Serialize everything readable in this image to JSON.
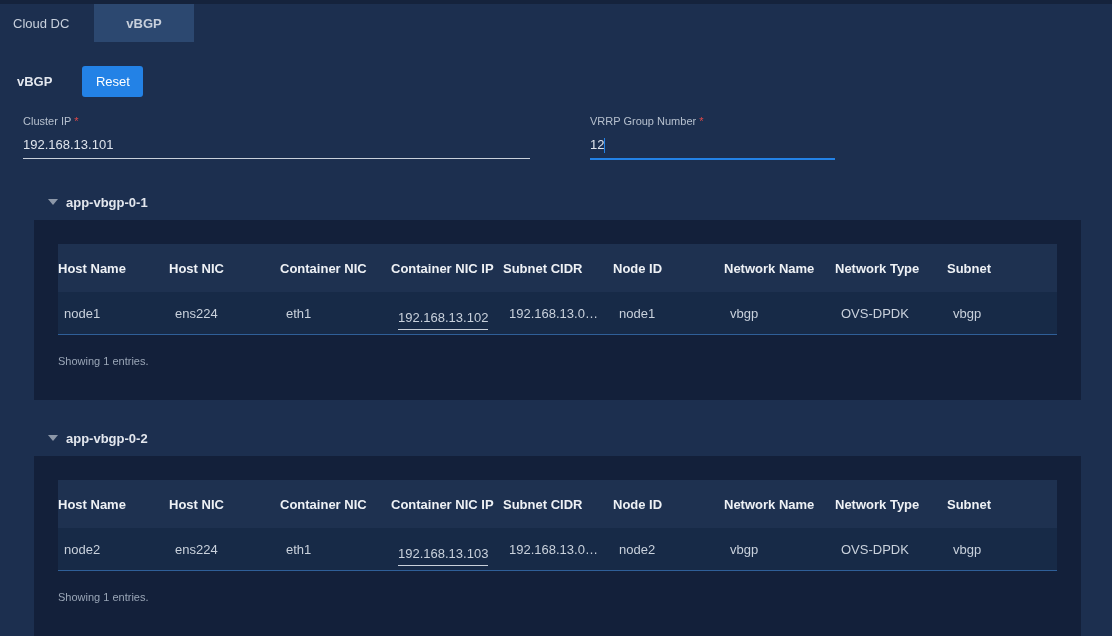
{
  "tabs": [
    {
      "label": "Cloud DC",
      "selected": false
    },
    {
      "label": "vBGP",
      "selected": true
    }
  ],
  "section": {
    "title": "vBGP",
    "reset_button": "Reset"
  },
  "fields": [
    {
      "label": "Cluster IP",
      "required_mark": "*",
      "value": "192.168.13.101",
      "focused": false
    },
    {
      "label": "VRRP Group Number",
      "required_mark": "*",
      "value": "12",
      "focused": true
    }
  ],
  "groups": [
    {
      "name": "app-vbgp-0-1",
      "expanded": true,
      "columns": [
        "Host Name",
        "Host NIC",
        "Container NIC",
        "Container NIC IP",
        "Subnet CIDR",
        "Node ID",
        "Network Name",
        "Network Type",
        "Subnet"
      ],
      "rows": [
        [
          "node1",
          "ens224",
          "eth1",
          "192.168.13.102",
          "192.168.13.0…",
          "node1",
          "vbgp",
          "OVS-DPDK",
          "vbgp"
        ]
      ],
      "footer": "Showing 1 entries."
    },
    {
      "name": "app-vbgp-0-2",
      "expanded": true,
      "columns": [
        "Host Name",
        "Host NIC",
        "Container NIC",
        "Container NIC IP",
        "Subnet CIDR",
        "Node ID",
        "Network Name",
        "Network Type",
        "Subnet"
      ],
      "rows": [
        [
          "node2",
          "ens224",
          "eth1",
          "192.168.13.103",
          "192.168.13.0…",
          "node2",
          "vbgp",
          "OVS-DPDK",
          "vbgp"
        ]
      ],
      "footer": "Showing 1 entries."
    }
  ]
}
